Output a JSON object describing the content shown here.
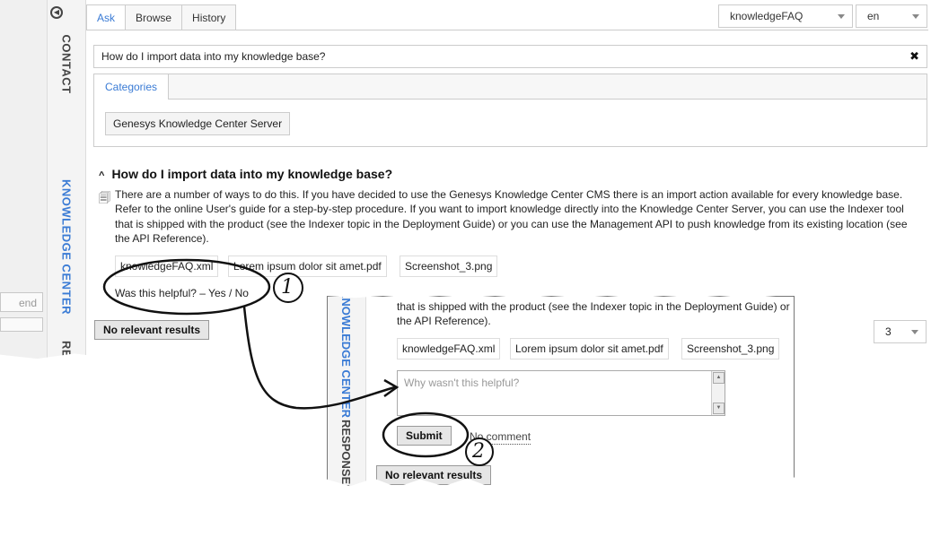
{
  "rail": {
    "contact_label": "CONTACT",
    "knowledge_label": "KNOWLEDGE CENTER",
    "cut_label": "RE",
    "cut_field": "end"
  },
  "tabs": [
    {
      "label": "Ask",
      "active": true
    },
    {
      "label": "Browse",
      "active": false
    },
    {
      "label": "History",
      "active": false
    }
  ],
  "kb_select": {
    "value": "knowledgeFAQ"
  },
  "lang_select": {
    "value": "en"
  },
  "question_input": {
    "value": "How do I import data into my knowledge base?",
    "clear_icon": "close-icon"
  },
  "categories": {
    "tab_label": "Categories",
    "items": [
      "Genesys Knowledge Center Server"
    ]
  },
  "result": {
    "title": "How do I import data into my knowledge base?",
    "answer": "There are a number of ways to do this. If you have decided to use the Genesys Knowledge Center CMS there is an import action available for every knowledge base. Refer to the online User's guide for a step-by-step procedure. If you want to import knowledge directly into the Knowledge Center Server, you can use the Indexer tool that is shipped with the product (see the Indexer topic in the Deployment Guide) or you can use the Management API to push knowledge from its existing location (see the API Reference).",
    "attachments": [
      "knowledgeFAQ.xml",
      "Lorem ipsum dolor sit amet.pdf",
      "Screenshot_3.png"
    ],
    "helpful_text": "Was this helpful? – Yes / No"
  },
  "no_results_button": "No relevant results",
  "pager": {
    "value": "3"
  },
  "zoom": {
    "rail_knowledge": "KNOWLEDGE CENTER",
    "rail_responses": "RESPONSES",
    "text_line1": "that is shipped with the product (see the Indexer topic in the Deployment Guide) or",
    "text_line2": "the API Reference).",
    "attachments": [
      "knowledgeFAQ.xml",
      "Lorem ipsum dolor sit amet.pdf",
      "Screenshot_3.png"
    ],
    "comment_placeholder": "Why wasn't this helpful?",
    "submit_label": "Submit",
    "no_comment_label": "No comment",
    "no_results_button": "No relevant results"
  },
  "annotations": {
    "step1": "1",
    "step2": "2"
  },
  "colors": {
    "accent": "#3a7bd5",
    "button_bg": "#e6e6e6"
  }
}
